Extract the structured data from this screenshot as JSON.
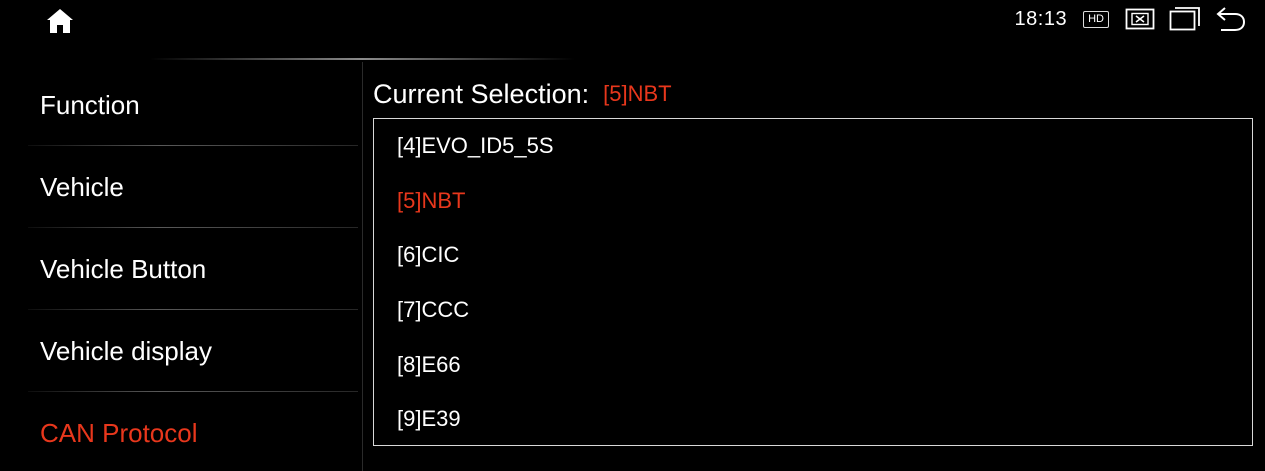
{
  "status_bar": {
    "time": "18:13",
    "hd_badge": "HD",
    "icons": [
      "home-icon",
      "close-box-icon",
      "recent-apps-icon",
      "back-icon"
    ]
  },
  "sidebar": {
    "items": [
      {
        "label": "Function",
        "active": false
      },
      {
        "label": "Vehicle",
        "active": false
      },
      {
        "label": "Vehicle Button",
        "active": false
      },
      {
        "label": "Vehicle display",
        "active": false
      },
      {
        "label": "CAN Protocol",
        "active": true
      }
    ]
  },
  "main": {
    "current_selection_label": "Current Selection:",
    "current_selection_value": "[5]NBT",
    "options": [
      {
        "label": "[4]EVO_ID5_5S",
        "selected": false
      },
      {
        "label": "[5]NBT",
        "selected": true
      },
      {
        "label": "[6]CIC",
        "selected": false
      },
      {
        "label": "[7]CCC",
        "selected": false
      },
      {
        "label": "[8]E66",
        "selected": false
      },
      {
        "label": "[9]E39",
        "selected": false
      }
    ]
  },
  "colors": {
    "background": "#000000",
    "text": "#ffffff",
    "accent": "#e8371c"
  }
}
